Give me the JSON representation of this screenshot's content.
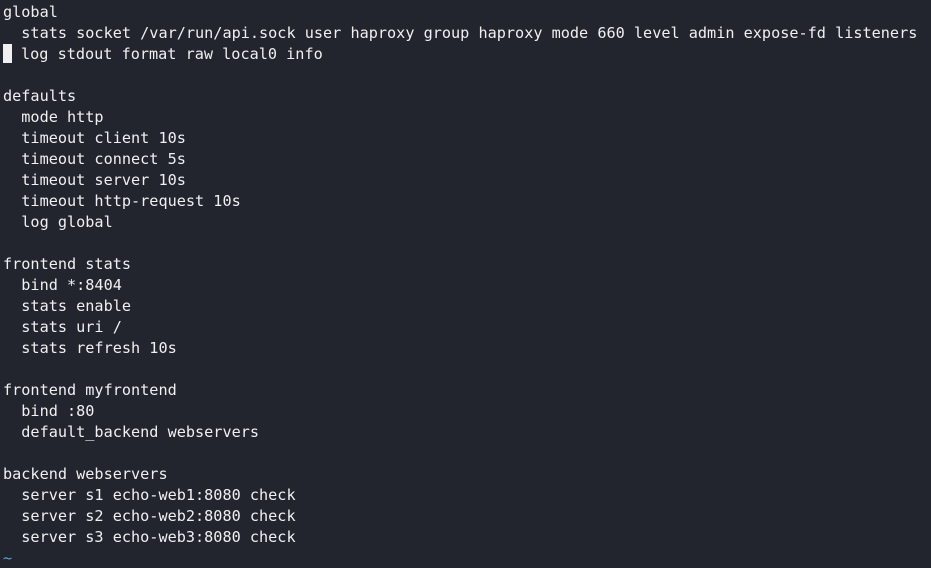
{
  "editor": {
    "lines": [
      "global",
      "  stats socket /var/run/api.sock user haproxy group haproxy mode 660 level admin expose-fd listeners",
      "log stdout format raw local0 info",
      "",
      "defaults",
      "  mode http",
      "  timeout client 10s",
      "  timeout connect 5s",
      "  timeout server 10s",
      "  timeout http-request 10s",
      "  log global",
      "",
      "frontend stats",
      "  bind *:8404",
      "  stats enable",
      "  stats uri /",
      "  stats refresh 10s",
      "",
      "frontend myfrontend",
      "  bind :80",
      "  default_backend webservers",
      "",
      "backend webservers",
      "  server s1 echo-web1:8080 check",
      "  server s2 echo-web2:8080 check",
      "  server s3 echo-web3:8080 check"
    ],
    "empty_line_marker": "~",
    "colors": {
      "background": "#22252d",
      "text": "#eef0f2",
      "cursor": "#f0f0f0",
      "tilde": "#5aa0d8"
    }
  }
}
